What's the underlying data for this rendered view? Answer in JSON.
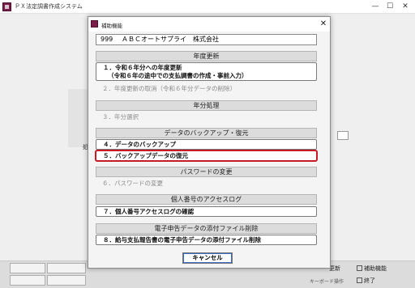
{
  "window": {
    "title": "ＰＸ法定調書作成システム",
    "minimize": "—",
    "maximize": "☐",
    "close": "✕"
  },
  "background": {
    "side_label": "処",
    "fn_update": "更新",
    "fn_help": "補助機能",
    "fn_keyboard": "キーボード操作",
    "fn_exit": "終了"
  },
  "dialog": {
    "title": "補助機能",
    "close": "✕",
    "company": {
      "code": "999",
      "name": "ＡＢＣオートサプライ　株式会社"
    },
    "sections": {
      "year_update": {
        "header": "年度更新",
        "item1_line1": "１．令和６年分への年度更新",
        "item1_line2": "（令和６年の途中での支払調書の作成・事前入力）",
        "item2": "２．年度更新の取消（令和６年分データの削除）"
      },
      "year_end": {
        "header": "年分処理",
        "item3": "３．年分選択"
      },
      "backup": {
        "header": "データのバックアップ・復元",
        "item4": "４．データのバックアップ",
        "item5": "５．バックアップデータの復元"
      },
      "password": {
        "header": "パスワードの変更",
        "item6": "６．パスワードの変更"
      },
      "access_log": {
        "header": "個人番号のアクセスログ",
        "item7": "７．個人番号アクセスログの確認"
      },
      "e_filing": {
        "header": "電子申告データの添付ファイル削除",
        "item8": "８．給与支払報告書の電子申告データの添付ファイル削除"
      }
    },
    "cancel_label": "キャンセル"
  },
  "colors": {
    "selected_border": "#c81a25",
    "app_icon": "#7a1f4a"
  }
}
